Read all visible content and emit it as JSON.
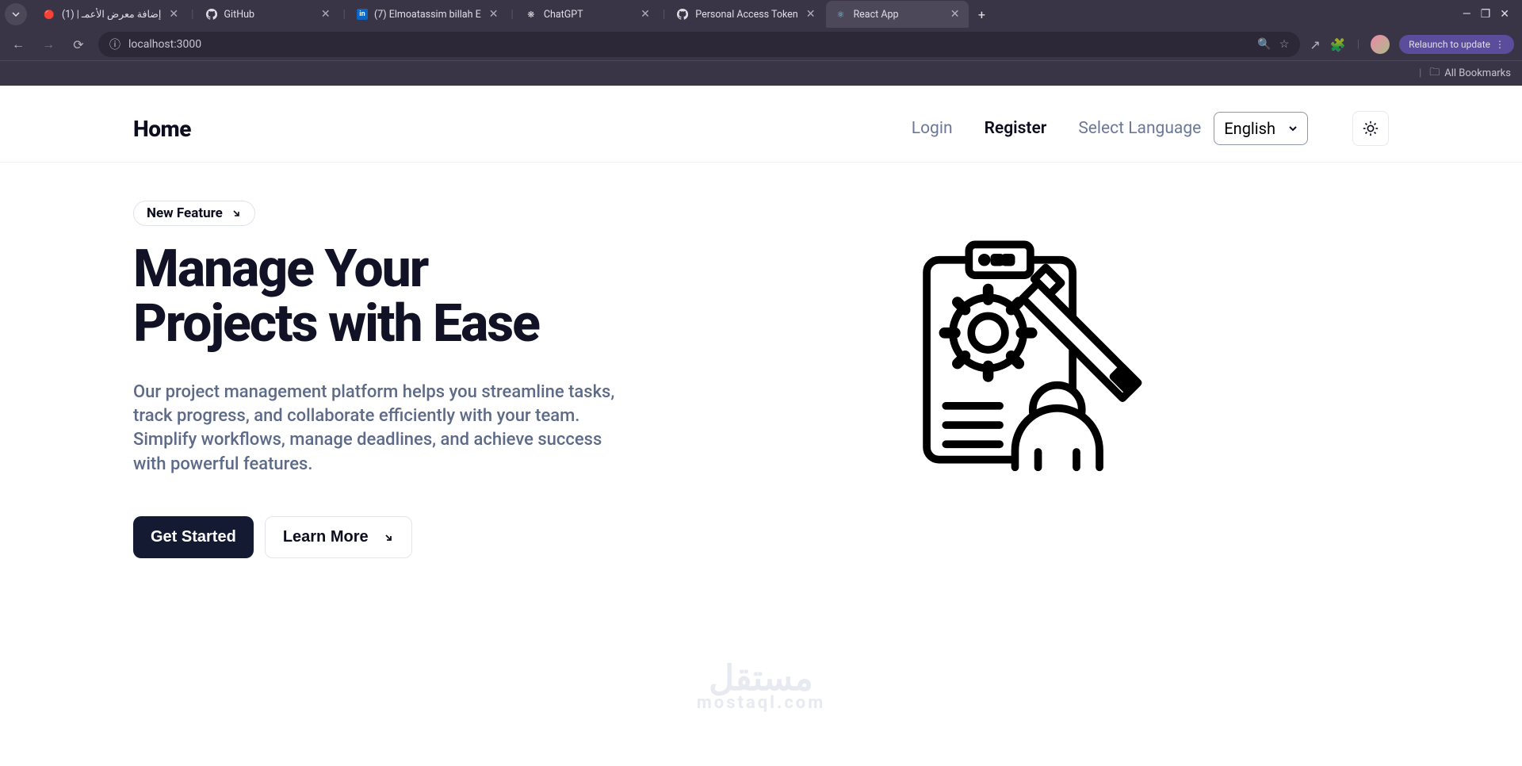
{
  "browser": {
    "tabs": [
      {
        "title": "(1) | إضافة معرض الأعمـ",
        "active": false
      },
      {
        "title": "GitHub",
        "active": false
      },
      {
        "title": "(7) Elmoatassim billah E",
        "active": false
      },
      {
        "title": "ChatGPT",
        "active": false
      },
      {
        "title": "Personal Access Token",
        "active": false
      },
      {
        "title": "React App",
        "active": true
      }
    ],
    "url": "localhost:3000",
    "relaunch": "Relaunch to update",
    "all_bookmarks": "All Bookmarks"
  },
  "nav": {
    "brand": "Home",
    "login": "Login",
    "register": "Register",
    "lang_label": "Select Language",
    "lang_value": "English"
  },
  "hero": {
    "badge": "New Feature",
    "title_l1": "Manage Your",
    "title_l2": "Projects with Ease",
    "desc": "Our project management platform helps you streamline tasks, track progress, and collaborate efficiently with your team. Simplify workflows, manage deadlines, and achieve success with powerful features.",
    "cta_primary": "Get Started",
    "cta_secondary": "Learn More"
  },
  "watermark": {
    "ar": "مستقل",
    "en": "mostaql.com"
  }
}
